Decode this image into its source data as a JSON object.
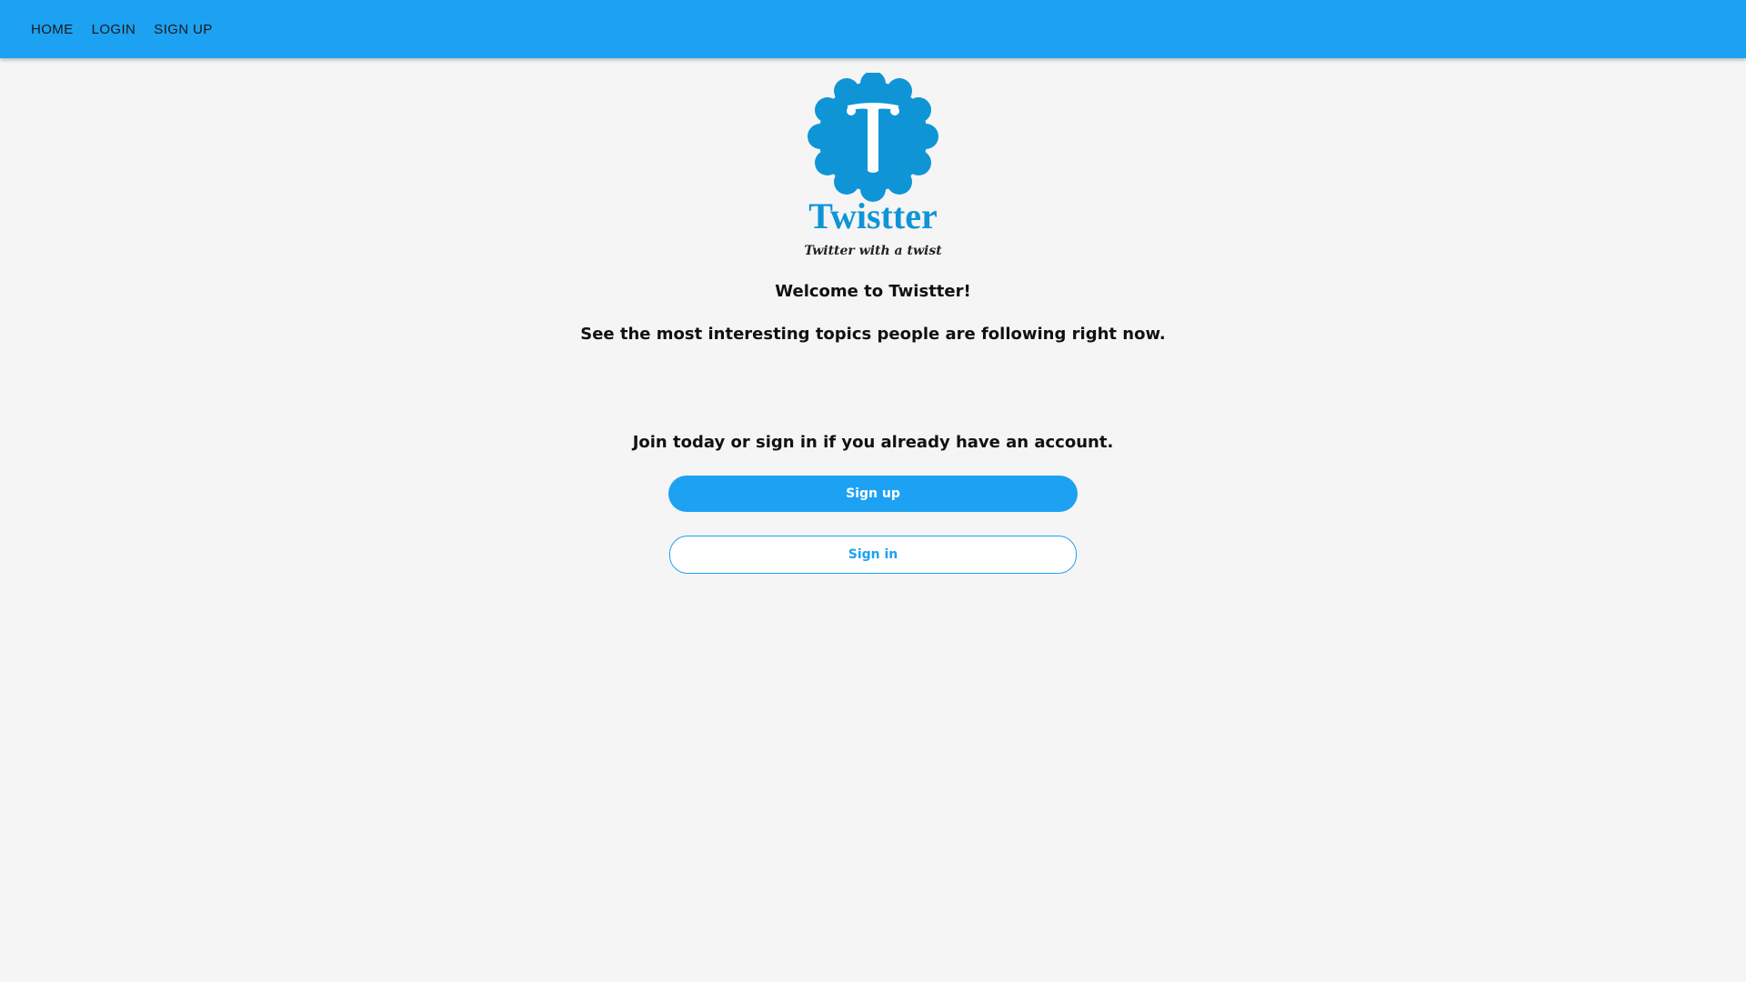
{
  "nav": {
    "items": [
      {
        "label": "HOME"
      },
      {
        "label": "LOGIN"
      },
      {
        "label": "SIGN UP"
      }
    ]
  },
  "logo": {
    "icon": "twistter-badge-icon",
    "wordmark": "Twistter",
    "slogan": "Twitter with a twist"
  },
  "content": {
    "welcome": "Welcome to Twistter!",
    "tagline": "See the most interesting topics people are following right now.",
    "join_prompt": "Join today or sign in if you already have an account.",
    "signup_label": "Sign up",
    "signin_label": "Sign in"
  },
  "colors": {
    "brand": "#1da1f2",
    "logo_blue": "#0f95d6",
    "background": "#f5f5f5"
  }
}
